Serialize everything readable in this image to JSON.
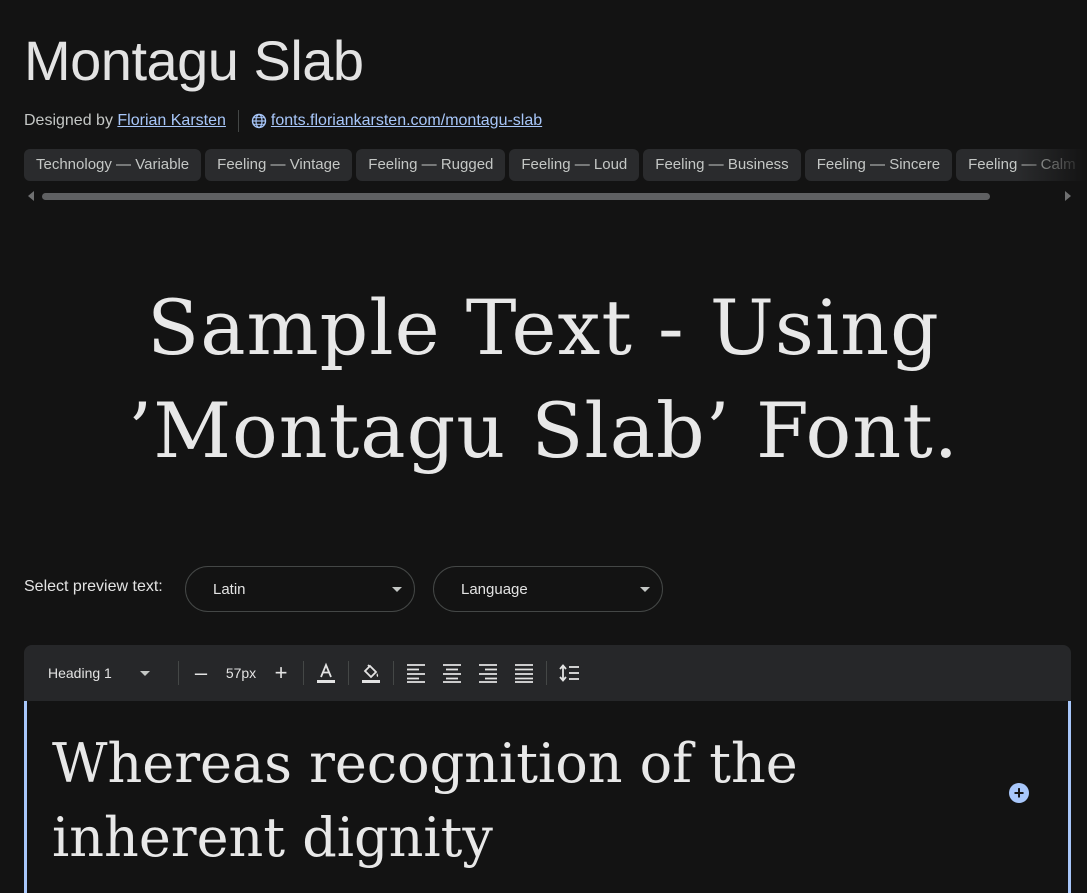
{
  "font": {
    "title": "Montagu Slab",
    "designed_by_label": "Designed by",
    "designer": "Florian Karsten",
    "website": "fonts.floriankarsten.com/montagu-slab"
  },
  "tags": [
    "Technology — Variable",
    "Feeling — Vintage",
    "Feeling — Rugged",
    "Feeling — Loud",
    "Feeling — Business",
    "Feeling — Sincere",
    "Feeling — Calm"
  ],
  "sample": {
    "line1": "Sample Text - Using",
    "line2": "’Montagu Slab’ Font."
  },
  "preview": {
    "label": "Select preview text:",
    "script_value": "Latin",
    "language_value": "Language"
  },
  "toolbar": {
    "style_value": "Heading 1",
    "size_value": "57px",
    "decrease_label": "–",
    "increase_label": "+"
  },
  "editor": {
    "text": "Whereas recognition of the inherent dignity"
  },
  "colors": {
    "background": "#131313",
    "accent": "#a8c7fa",
    "toolbar": "#262729"
  }
}
